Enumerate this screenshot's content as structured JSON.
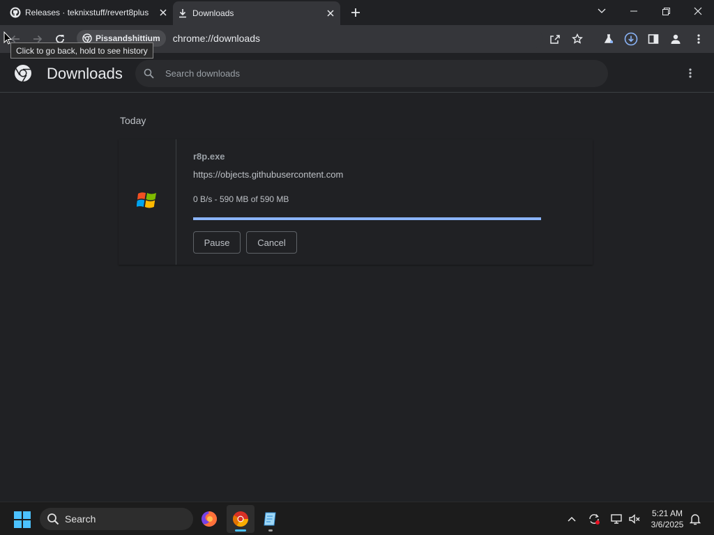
{
  "tabs": [
    {
      "title": "Releases · teknixstuff/revert8plus",
      "icon": "github-icon"
    },
    {
      "title": "Downloads",
      "icon": "download-icon"
    }
  ],
  "toolbar": {
    "profile_chip": "Pissandshittium",
    "url": "chrome://downloads",
    "tooltip": "Click to go back, hold to see history"
  },
  "downloads_page": {
    "title": "Downloads",
    "search_placeholder": "Search downloads",
    "section_date": "Today",
    "item": {
      "filename": "r8p.exe",
      "source_url": "https://objects.githubusercontent.com",
      "status": "0 B/s - 590 MB of 590 MB",
      "progress_percent": 100,
      "pause_label": "Pause",
      "cancel_label": "Cancel"
    }
  },
  "taskbar": {
    "search_label": "Search",
    "time": "5:21 AM",
    "date": "3/6/2025"
  },
  "colors": {
    "accent": "#8ab4f8",
    "background": "#202124",
    "toolbar": "#35363a"
  }
}
